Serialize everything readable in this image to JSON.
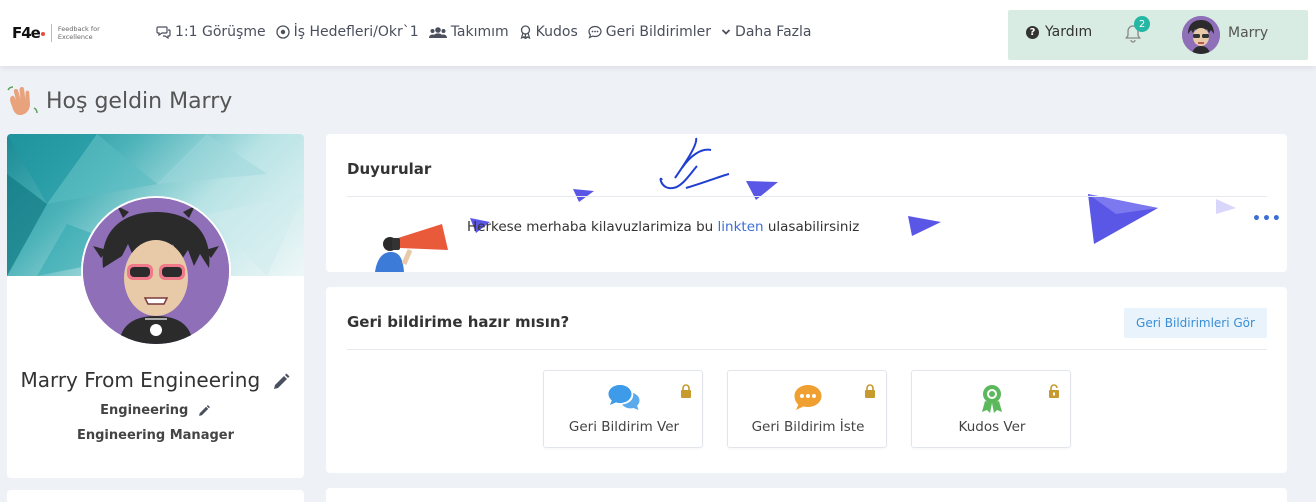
{
  "logo": {
    "mark": "F4e",
    "tagline": "Feedback for Excellence"
  },
  "nav": {
    "items": [
      {
        "label": "1:1 Görüşme",
        "icon": "chat-icon"
      },
      {
        "label": "İş Hedefleri/Okr`1",
        "icon": "target-icon"
      },
      {
        "label": "Takımım",
        "icon": "users-icon"
      },
      {
        "label": "Kudos",
        "icon": "award-icon"
      },
      {
        "label": "Geri Bildirimler",
        "icon": "comment-icon"
      },
      {
        "label": "Daha Fazla",
        "icon": "chevron-down-icon"
      }
    ],
    "help_label": "Yardım",
    "notification_count": "2",
    "user_name": "Marry"
  },
  "welcome": {
    "text": "Hoş geldin Marry"
  },
  "profile": {
    "name": "Marry From Engineering",
    "department": "Engineering",
    "title": "Engineering Manager"
  },
  "announcements": {
    "title": "Duyurular",
    "text_before": "Herkese merhaba kilavuzlarimiza bu ",
    "link_text": "linkten",
    "text_after": " ulasabilirsiniz",
    "more": "•••"
  },
  "feedback": {
    "title": "Geri bildirime hazır mısın?",
    "see_button": "Geri Bildirimleri Gör",
    "tiles": [
      {
        "label": "Geri Bildirim Ver",
        "icon": "chat-bubbles-icon",
        "color": "#3d9be9",
        "locked": true
      },
      {
        "label": "Geri Bildirim İste",
        "icon": "speech-bubble-icon",
        "color": "#f0a030",
        "locked": true
      },
      {
        "label": "Kudos Ver",
        "icon": "ribbon-award-icon",
        "color": "#5cb85c",
        "locked": false
      }
    ]
  },
  "colors": {
    "accent": "#3b6fd4",
    "teal": "#25b7a3",
    "lock": "#c79a2e"
  }
}
